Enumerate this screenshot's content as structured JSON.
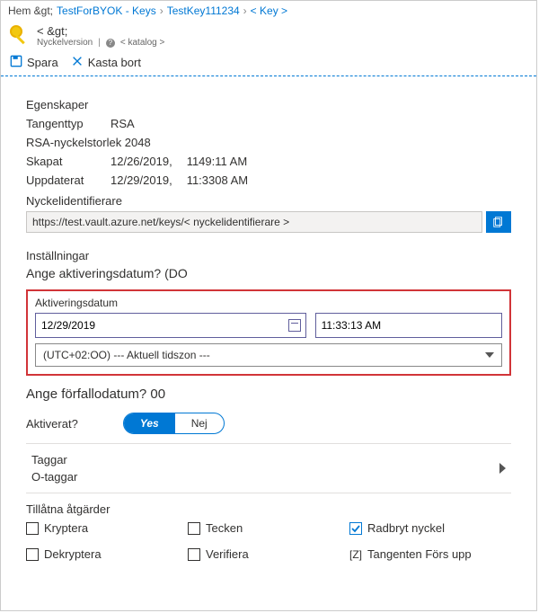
{
  "breadcrumb": {
    "home": "Hem &gt;",
    "crumb1": "TestForBYOK - Keys",
    "crumb2": "TestKey111234",
    "crumb3": "< Key >"
  },
  "header": {
    "title": "< &gt;",
    "subtitle": "Nyckelversion",
    "catalog": "< katalog >"
  },
  "toolbar": {
    "save": "Spara",
    "discard": "Kasta bort"
  },
  "props": {
    "section": "Egenskaper",
    "key_type_label": "Tangenttyp",
    "key_type_value": "RSA",
    "rsa_size": "RSA-nyckelstorlek 2048",
    "created_label": "Skapat",
    "created_date": "12/26/2019,",
    "created_time": "1149:11 AM",
    "updated_label": "Uppdaterat",
    "updated_date": "12/29/2019,",
    "updated_time": "11:3308 AM",
    "kvid_label": "Nyckelidentifierare",
    "kvid_value": "https://test.vault.azure.net/keys/< nyckelidentifierare >"
  },
  "settings": {
    "section": "Inställningar",
    "act_q": "Ange aktiveringsdatum? (DO",
    "act_label": "Aktiveringsdatum",
    "act_date": "12/29/2019",
    "act_time": "11:33:13 AM",
    "tz": "(UTC+02:OO) --- Aktuell tidszon       ---",
    "exp_q": "Ange förfallodatum? 00",
    "enabled_label": "Aktiverat?",
    "yes": "Yes",
    "no": "Nej"
  },
  "tags": {
    "label": "Taggar",
    "value": "O-taggar"
  },
  "ops": {
    "title": "Tillåtna åtgärder",
    "encrypt": "Kryptera",
    "decrypt": "Dekryptera",
    "sign": "Tecken",
    "verify": "Verifiera",
    "wrap": "Radbryt nyckel",
    "unwrap": "Tangenten Förs upp"
  }
}
